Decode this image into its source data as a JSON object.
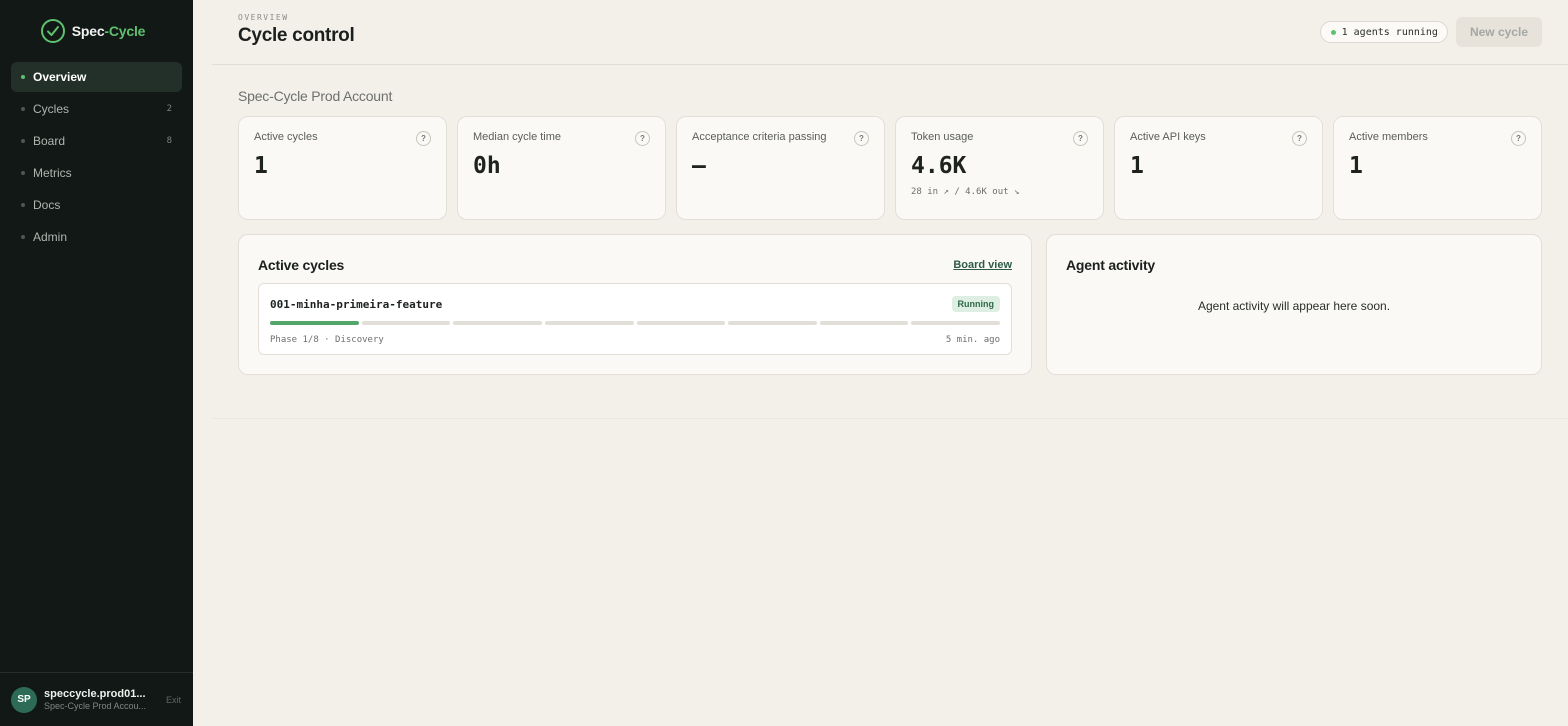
{
  "brand": {
    "name_main": "Spec",
    "name_accent": "-Cycle",
    "accent_color": "#5fc070"
  },
  "sidebar": {
    "items": [
      {
        "label": "Overview",
        "count": ""
      },
      {
        "label": "Cycles",
        "count": "2"
      },
      {
        "label": "Board",
        "count": "8"
      },
      {
        "label": "Metrics",
        "count": ""
      },
      {
        "label": "Docs",
        "count": ""
      },
      {
        "label": "Admin",
        "count": ""
      }
    ],
    "user": {
      "initials": "SP",
      "name": "speccycle.prod01...",
      "account": "Spec-Cycle Prod Accou...",
      "exit_label": "Exit"
    }
  },
  "header": {
    "eyebrow": "OVERVIEW",
    "title": "Cycle control",
    "agents_status": "1 agents running",
    "new_cycle_label": "New cycle"
  },
  "account_name": "Spec-Cycle Prod Account",
  "stats": [
    {
      "label": "Active cycles",
      "value": "1",
      "sub": ""
    },
    {
      "label": "Median cycle time",
      "value": "0h",
      "sub": ""
    },
    {
      "label": "Acceptance criteria passing",
      "value": "—",
      "sub": ""
    },
    {
      "label": "Token usage",
      "value": "4.6K",
      "sub": "28 in ↗ / 4.6K out ↘"
    },
    {
      "label": "Active API keys",
      "value": "1",
      "sub": ""
    },
    {
      "label": "Active members",
      "value": "1",
      "sub": ""
    }
  ],
  "active_cycles": {
    "title": "Active cycles",
    "board_link": "Board view",
    "cycle": {
      "name": "001-minha-primeira-feature",
      "status": "Running",
      "phase": "Phase 1/8 · Discovery",
      "updated": "5 min. ago",
      "phases_total": 8,
      "phases_done": 1
    }
  },
  "agent_activity": {
    "title": "Agent activity",
    "empty_message": "Agent activity will appear here soon."
  }
}
